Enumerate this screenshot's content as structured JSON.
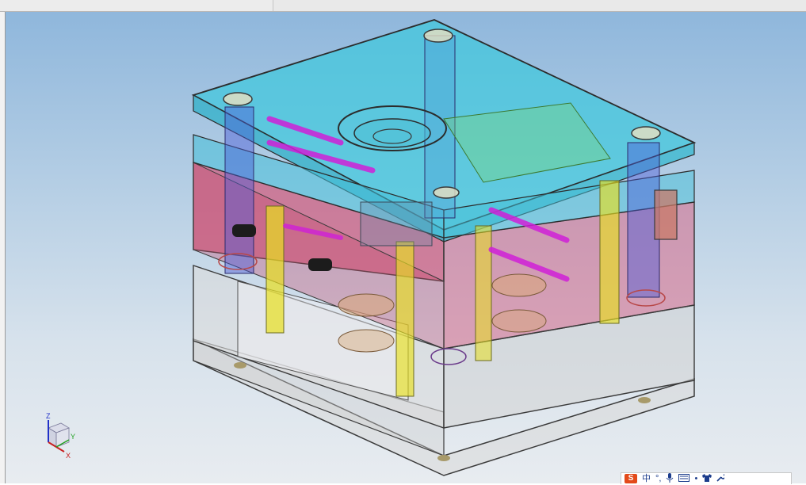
{
  "triad": {
    "z": "Z",
    "y": "Y",
    "x": "X"
  },
  "ime_toolbar": {
    "logo": "S",
    "lang": "中",
    "punct": "°,",
    "voice": "mic-icon",
    "keyboard": "keyboard-icon",
    "dot": "•",
    "skin": "shirt-icon",
    "tools": "wrench-icon"
  },
  "colors": {
    "top_plate": "#3fc8dc",
    "cavity_plate": "#d2587a",
    "rails": "#d8d8d8",
    "pins": "#e8e020",
    "water_channels": "#d020d8"
  }
}
